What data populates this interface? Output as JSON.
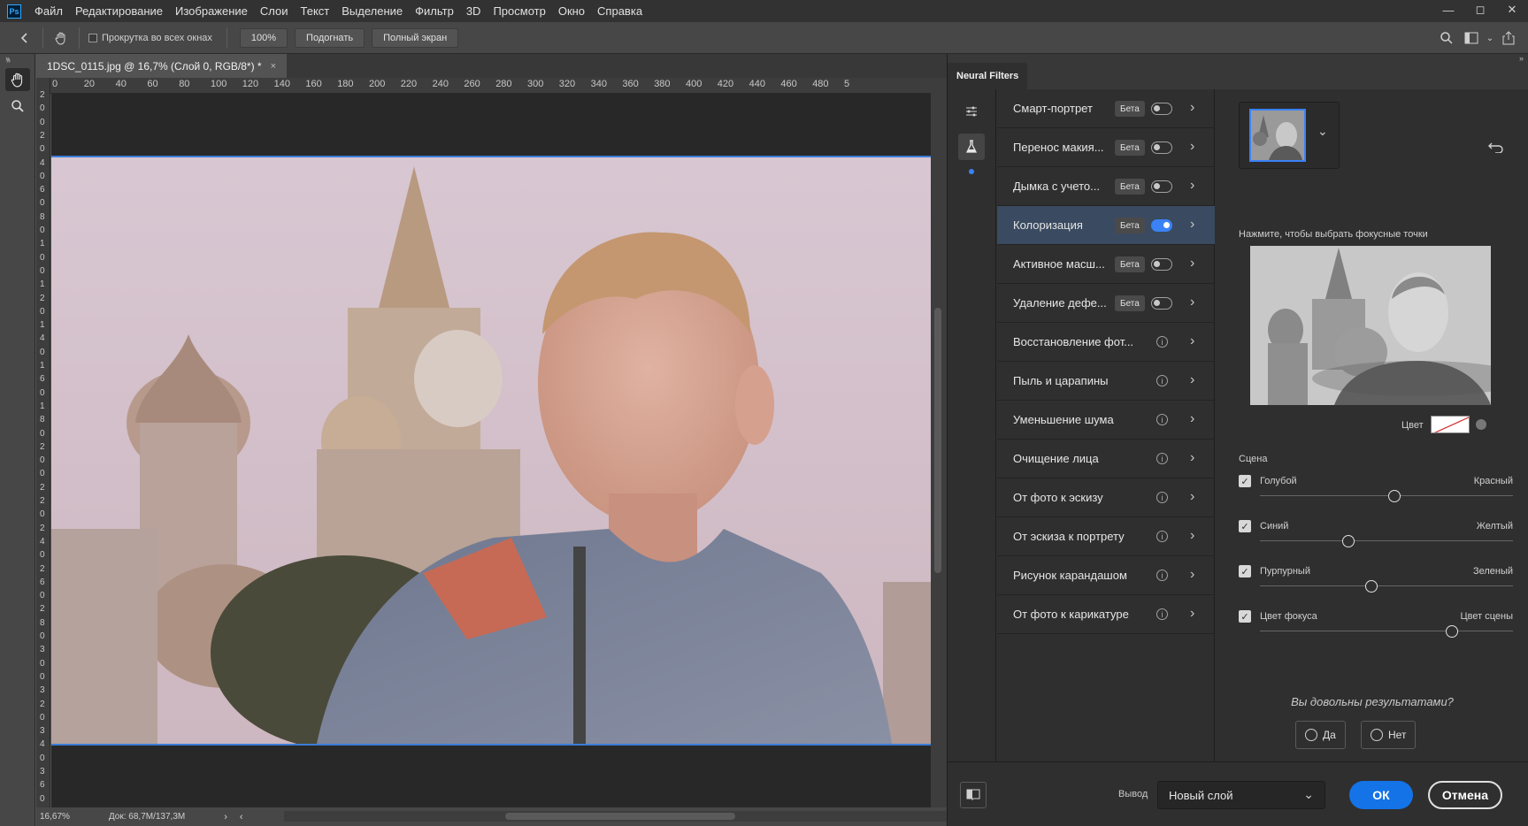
{
  "app": {
    "logo": "Ps"
  },
  "menu": [
    "Файл",
    "Редактирование",
    "Изображение",
    "Слои",
    "Текст",
    "Выделение",
    "Фильтр",
    "3D",
    "Просмотр",
    "Окно",
    "Справка"
  ],
  "window_controls": {
    "minimize": "—",
    "restore": "◻",
    "close": "✕"
  },
  "options": {
    "scroll_all_windows": "Прокрутка во всех окнах",
    "zoom_100": "100%",
    "fit": "Подогнать",
    "fullscreen": "Полный экран"
  },
  "document": {
    "tab_title": "1DSC_0115.jpg @ 16,7% (Слой 0, RGB/8*) *",
    "tab_close": "×",
    "zoom": "16,67%",
    "doc_info": "Док: 68,7M/137,3M"
  },
  "ruler_h": [
    "0",
    "20",
    "40",
    "60",
    "80",
    "100",
    "120",
    "140",
    "160",
    "180",
    "200",
    "220",
    "240",
    "260",
    "280",
    "300",
    "320",
    "340",
    "360",
    "380",
    "400",
    "420",
    "440",
    "460",
    "480",
    "5"
  ],
  "ruler_v": [
    "2",
    "0",
    "0",
    "2",
    "0",
    "4",
    "0",
    "6",
    "0",
    "8",
    "0",
    "1",
    "0",
    "0",
    "1",
    "2",
    "0",
    "1",
    "4",
    "0",
    "1",
    "6",
    "0",
    "1",
    "8",
    "0",
    "2",
    "0",
    "0",
    "2",
    "2",
    "0",
    "2",
    "4",
    "0",
    "2",
    "6",
    "0",
    "2",
    "8",
    "0",
    "3",
    "0",
    "0",
    "3",
    "2",
    "0",
    "3",
    "4",
    "0",
    "3",
    "6",
    "0"
  ],
  "neural_filters": {
    "tab": "Neural Filters",
    "filters": [
      {
        "name": "Смарт-портрет",
        "badge": "Бета",
        "kind": "toggle",
        "on": false
      },
      {
        "name": "Перенос макия...",
        "badge": "Бета",
        "kind": "toggle",
        "on": false
      },
      {
        "name": "Дымка с учето...",
        "badge": "Бета",
        "kind": "toggle",
        "on": false
      },
      {
        "name": "Колоризация",
        "badge": "Бета",
        "kind": "toggle",
        "on": true
      },
      {
        "name": "Активное масш...",
        "badge": "Бета",
        "kind": "toggle",
        "on": false
      },
      {
        "name": "Удаление дефе...",
        "badge": "Бета",
        "kind": "toggle",
        "on": false
      },
      {
        "name": "Восстановление фот...",
        "badge": "",
        "kind": "info"
      },
      {
        "name": "Пыль и царапины",
        "badge": "",
        "kind": "info"
      },
      {
        "name": "Уменьшение шума",
        "badge": "",
        "kind": "info"
      },
      {
        "name": "Очищение лица",
        "badge": "",
        "kind": "info"
      },
      {
        "name": "От фото к эскизу",
        "badge": "",
        "kind": "info"
      },
      {
        "name": "От эскиза к портрету",
        "badge": "",
        "kind": "info"
      },
      {
        "name": "Рисунок карандашом",
        "badge": "",
        "kind": "info"
      },
      {
        "name": "От фото к карикатуре",
        "badge": "",
        "kind": "info"
      }
    ],
    "settings": {
      "focus_hint": "Нажмите, чтобы выбрать фокусные точки",
      "color_label": "Цвет",
      "scene_label": "Сцена",
      "sliders": [
        {
          "left": "Голубой",
          "right": "Красный",
          "checked": true,
          "value": 0.53
        },
        {
          "left": "Синий",
          "right": "Желтый",
          "checked": true,
          "value": 0.35
        },
        {
          "left": "Пурпурный",
          "right": "Зеленый",
          "checked": true,
          "value": 0.44
        },
        {
          "left": "Цвет фокуса",
          "right": "Цвет сцены",
          "checked": true,
          "value": 0.76
        }
      ],
      "satisfied_question": "Вы довольны результатами?",
      "yes": "Да",
      "no": "Нет"
    },
    "footer": {
      "output_label": "Вывод",
      "output_value": "Новый слой",
      "ok": "ОК",
      "cancel": "Отмена"
    }
  },
  "colors": {
    "accent": "#1473e6",
    "toggle_on": "#3b82f6",
    "selection_row": "#3a4a60"
  }
}
